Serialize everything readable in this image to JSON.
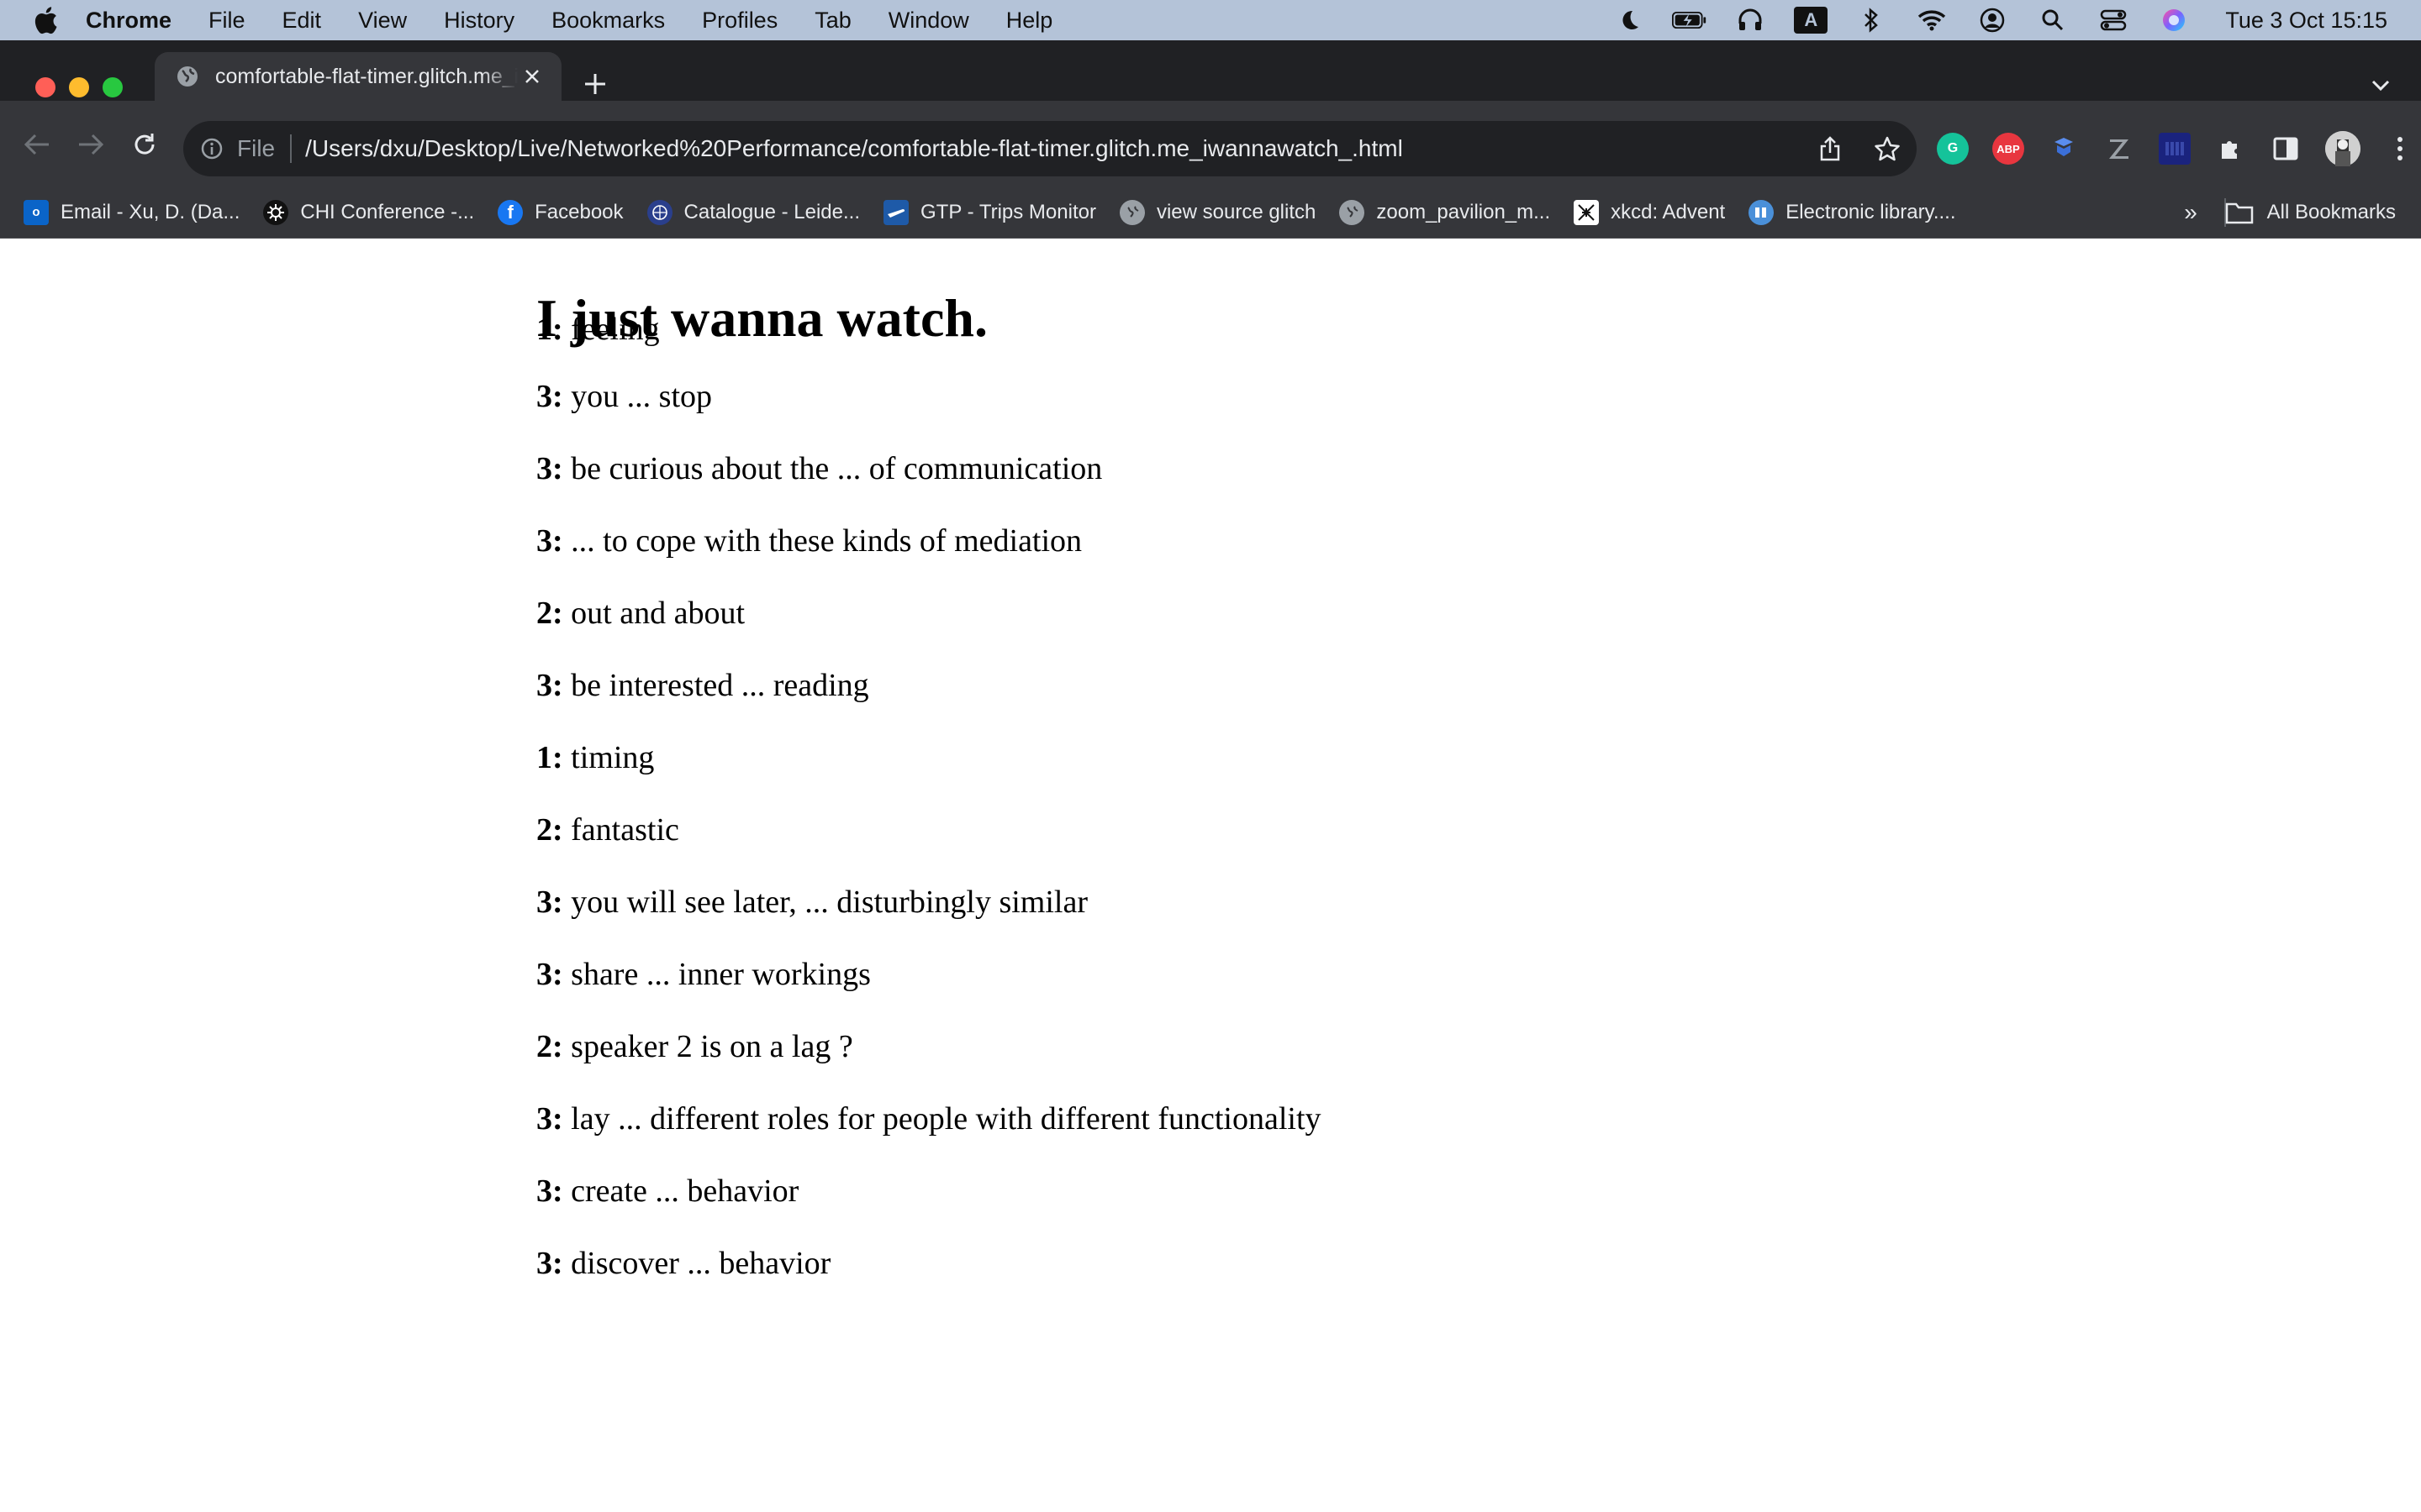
{
  "menubar": {
    "app": "Chrome",
    "items": [
      "File",
      "Edit",
      "View",
      "History",
      "Bookmarks",
      "Profiles",
      "Tab",
      "Window",
      "Help"
    ],
    "clock": "Tue 3 Oct  15:15",
    "input_source": "A"
  },
  "tab": {
    "title": "comfortable-flat-timer.glitch.me_iwannawatch_.html"
  },
  "omnibox": {
    "scheme": "File",
    "url": "/Users/dxu/Desktop/Live/Networked%20Performance/comfortable-flat-timer.glitch.me_iwannawatch_.html"
  },
  "bookmarks": {
    "items": [
      {
        "label": "Email - Xu, D. (Da...",
        "icon": "outlook-icon"
      },
      {
        "label": "CHI Conference -...",
        "icon": "chi-icon"
      },
      {
        "label": "Facebook",
        "icon": "facebook-icon"
      },
      {
        "label": "Catalogue - Leide...",
        "icon": "leiden-icon"
      },
      {
        "label": "GTP - Trips Monitor",
        "icon": "plane-icon"
      },
      {
        "label": "view source glitch",
        "icon": "globe-icon"
      },
      {
        "label": "zoom_pavilion_m...",
        "icon": "globe-icon"
      },
      {
        "label": "xkcd: Advent",
        "icon": "xkcd-icon"
      },
      {
        "label": "Electronic library....",
        "icon": "library-icon"
      }
    ],
    "more": "»",
    "all_label": "All Bookmarks"
  },
  "page": {
    "title": "I just wanna watch.",
    "overlap_speaker": "1:",
    "overlap_text": "feeling",
    "lines": [
      {
        "speaker": "3:",
        "text": "you ... stop"
      },
      {
        "speaker": "3:",
        "text": "be curious about the ... of communication"
      },
      {
        "speaker": "3:",
        "text": "... to cope with these kinds of mediation"
      },
      {
        "speaker": "2:",
        "text": "out and about"
      },
      {
        "speaker": "3:",
        "text": "be interested ... reading"
      },
      {
        "speaker": "1:",
        "text": "timing"
      },
      {
        "speaker": "2:",
        "text": "fantastic"
      },
      {
        "speaker": "3:",
        "text": "you will see later, ... disturbingly similar"
      },
      {
        "speaker": "3:",
        "text": "share ... inner workings"
      },
      {
        "speaker": "2:",
        "text": "speaker 2 is on a lag ?"
      },
      {
        "speaker": "3:",
        "text": "lay ... different roles for people with different functionality"
      },
      {
        "speaker": "3:",
        "text": "create ... behavior"
      },
      {
        "speaker": "3:",
        "text": "discover ... behavior"
      }
    ]
  },
  "colors": {
    "menubar_bg": "#b4c3d8",
    "chrome_dark": "#202124",
    "toolbar": "#35363a"
  }
}
